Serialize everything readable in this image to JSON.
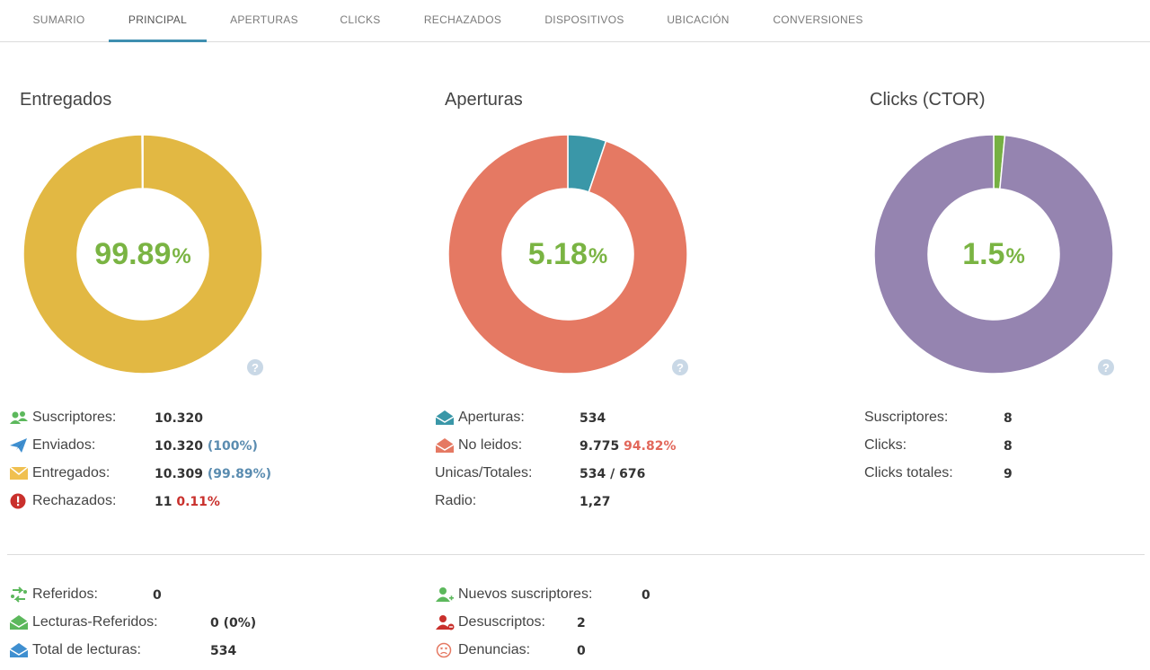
{
  "tabs": [
    {
      "label": "SUMARIO"
    },
    {
      "label": "PRINCIPAL"
    },
    {
      "label": "APERTURAS"
    },
    {
      "label": "CLICKS"
    },
    {
      "label": "RECHAZADOS"
    },
    {
      "label": "DISPOSITIVOS"
    },
    {
      "label": "UBICACIÓN"
    },
    {
      "label": "CONVERSIONES"
    }
  ],
  "active_tab": "PRINCIPAL",
  "cards": [
    {
      "title": "Entregados",
      "center_value": "99.89",
      "center_unit": "%",
      "fraction": 0.9989,
      "main_color": "#e2b843",
      "accent_color": "#ffffff",
      "stats": [
        {
          "icon": "users-icon",
          "label": "Suscriptores:",
          "value": "10.320",
          "extra": ""
        },
        {
          "icon": "paper-plane-icon",
          "label": "Enviados:",
          "value": "10.320",
          "extra": "(100%)"
        },
        {
          "icon": "envelope-icon",
          "label": "Entregados:",
          "value": "10.309",
          "extra": "(99.89%)"
        },
        {
          "icon": "exclamation-icon",
          "label": "Rechazados:",
          "value": "11",
          "extra": "0.11%"
        }
      ]
    },
    {
      "title": "Aperturas",
      "center_value": "5.18",
      "center_unit": "%",
      "fraction": 0.0518,
      "main_color": "#e57963",
      "accent_color": "#3a97a8",
      "stats": [
        {
          "icon": "open-envelope-icon",
          "label": "Aperturas:",
          "value": "534",
          "extra": ""
        },
        {
          "icon": "closed-envelope-icon",
          "label": "No leidos:",
          "value": "9.775",
          "extra": "94.82%"
        },
        {
          "icon": "",
          "label": "Unicas/Totales:",
          "value": "534 / 676",
          "extra": ""
        },
        {
          "icon": "",
          "label": "Radio:",
          "value": "1,27",
          "extra": ""
        }
      ]
    },
    {
      "title": "Clicks (CTOR)",
      "center_value": "1.5",
      "center_unit": "%",
      "fraction": 0.015,
      "main_color": "#9584b0",
      "accent_color": "#76b043",
      "stats": [
        {
          "icon": "",
          "label": "Suscriptores:",
          "value": "8",
          "extra": ""
        },
        {
          "icon": "",
          "label": "Clicks:",
          "value": "8",
          "extra": ""
        },
        {
          "icon": "",
          "label": "Clicks totales:",
          "value": "9",
          "extra": ""
        }
      ]
    }
  ],
  "bottom_left": [
    {
      "icon": "refer-icon",
      "label": "Referidos:",
      "value": "0"
    },
    {
      "icon": "open-envelope-green-icon",
      "label": "Lecturas-Referidos:",
      "value": "0 (0%)"
    },
    {
      "icon": "open-envelope-blue-icon",
      "label": "Total de lecturas:",
      "value": "534"
    }
  ],
  "bottom_right": [
    {
      "icon": "user-add-icon",
      "label": "Nuevos suscriptores:",
      "value": "0"
    },
    {
      "icon": "user-remove-icon",
      "label": "Desuscriptos:",
      "value": "2"
    },
    {
      "icon": "complaint-icon",
      "label": "Denuncias:",
      "value": "0"
    }
  ],
  "help_label": "?"
}
